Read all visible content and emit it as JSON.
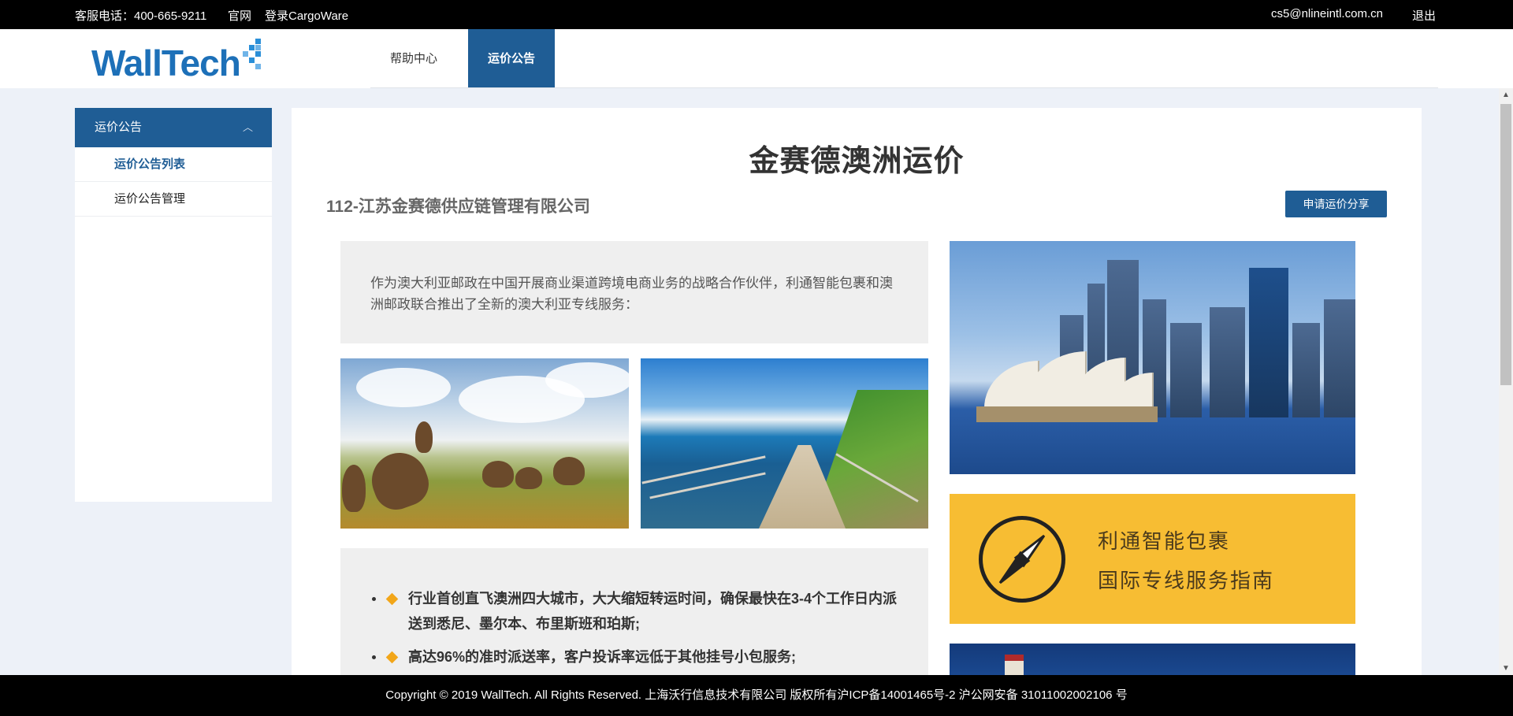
{
  "topbar": {
    "phone": "客服电话：400-665-9211",
    "official_site": "官网",
    "login_cargoware": "登录CargoWare",
    "email": "cs5@nlineintl.com.cn",
    "logout": "退出"
  },
  "header": {
    "logo_text": "WallTech",
    "nav": {
      "help_center": "帮助中心",
      "price_notice": "运价公告"
    }
  },
  "sidebar": {
    "section_title": "运价公告",
    "items": [
      {
        "label": "运价公告列表",
        "active": true
      },
      {
        "label": "运价公告管理",
        "active": false
      }
    ]
  },
  "main": {
    "title": "金赛德澳洲运价",
    "company": "112-江苏金赛德供应链管理有限公司",
    "share_button": "申请运价分享",
    "intro": "作为澳大利亚邮政在中国开展商业渠道跨境电商业务的战略合作伙伴，利通智能包裹和澳洲邮政联合推出了全新的澳大利亚专线服务：",
    "guide_banner": {
      "line1": "利通智能包裹",
      "line2": "国际专线服务指南"
    },
    "features": [
      "行业首创直飞澳洲四大城市，大大缩短转运时间，确保最快在3-4个工作日内派送到悉尼、墨尔本、布里斯班和珀斯;",
      "高达96%的准时派送率，客户投诉率远低于其他挂号小包服务;"
    ],
    "images": {
      "kangaroo": "kangaroo-field-photo",
      "coast": "coastal-walkway-photo",
      "sydney": "sydney-opera-house-photo",
      "lighthouse": "lighthouse-photo"
    }
  },
  "footer": {
    "copyright": "Copyright © 2019 WallTech. All Rights Reserved. 上海沃行信息技术有限公司 版权所有沪ICP备14001465号-2 沪公网安备 31011002002106 号"
  },
  "colors": {
    "brand_blue": "#1f5d95",
    "banner_yellow": "#f7bd33",
    "page_bg": "#edf1f8"
  }
}
